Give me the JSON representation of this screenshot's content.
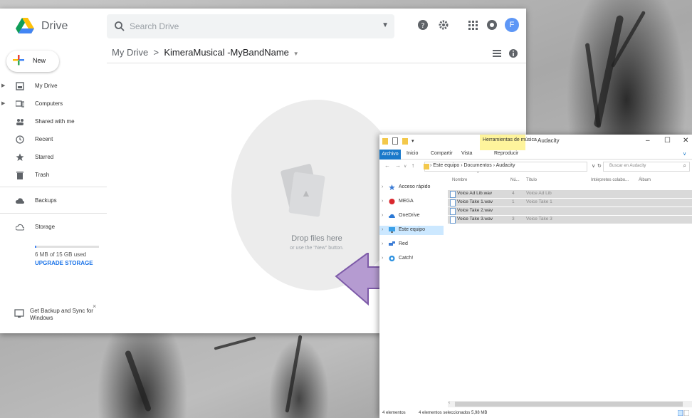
{
  "drive": {
    "app_name": "Drive",
    "search_placeholder": "Search Drive",
    "avatar_letter": "F",
    "breadcrumb_root": "My Drive",
    "breadcrumb_sep": ">",
    "breadcrumb_folder": "KimeraMusical -MyBandName",
    "new_label": "New",
    "nav": [
      {
        "label": "My Drive",
        "icon": "drive-icon"
      },
      {
        "label": "Computers",
        "icon": "computer-icon"
      },
      {
        "label": "Shared with me",
        "icon": "people-icon"
      },
      {
        "label": "Recent",
        "icon": "clock-icon"
      },
      {
        "label": "Starred",
        "icon": "star-icon"
      },
      {
        "label": "Trash",
        "icon": "trash-icon"
      },
      {
        "label": "Backups",
        "icon": "cloud-icon"
      },
      {
        "label": "Storage",
        "icon": "cloud-outline-icon"
      }
    ],
    "storage_used": "6 MB of 15 GB used",
    "storage_fraction": 0.0004,
    "upgrade_label": "UPGRADE STORAGE",
    "backup_promo": "Get Backup and Sync for Windows",
    "close_glyph": "×",
    "drop_title": "Drop files here",
    "drop_sub": "or use the \"New\" button."
  },
  "explorer": {
    "ribbon_context": "Herramientas de música",
    "ribbon_context_tab": "Reproducir",
    "app_title": "Audacity",
    "tabs": {
      "archivo": "Archivo",
      "inicio": "Inicio",
      "compartir": "Compartir",
      "vista": "Vista"
    },
    "window_buttons": {
      "min": "–",
      "max": "☐",
      "close": "✕"
    },
    "address_path": "›  Este equipo  ›  Documentos  ›  Audacity",
    "search_placeholder": "Buscar en Audacity",
    "tree": [
      {
        "label": "Acceso rápido",
        "icon": "star-icon",
        "color": "#3a7bd5"
      },
      {
        "label": "MEGA",
        "icon": "mega-icon",
        "color": "#d9272e"
      },
      {
        "label": "OneDrive",
        "icon": "onedrive-icon",
        "color": "#2a78d5"
      },
      {
        "label": "Este equipo",
        "icon": "pc-icon",
        "color": "#3aa0e8"
      },
      {
        "label": "Red",
        "icon": "network-icon",
        "color": "#3a7bd5"
      },
      {
        "label": "Catch!",
        "icon": "catch-icon",
        "color": "#2a90e0"
      }
    ],
    "columns": {
      "name": "Nombre",
      "num": "Nú...",
      "title": "Título",
      "artists": "Intérpretes colabo...",
      "album": "Álbum"
    },
    "files": [
      {
        "name": "Voice Ad Lib.wav",
        "num": "4",
        "title": "Voice Ad Lib"
      },
      {
        "name": "Voice Take 1.wav",
        "num": "1",
        "title": "Voice Take 1"
      },
      {
        "name": "Voice Take 2.wav",
        "num": "",
        "title": ""
      },
      {
        "name": "Voice Take 3.wav",
        "num": "3",
        "title": "Voice Take 3"
      }
    ],
    "status_count": "4 elementos",
    "status_selected": "4 elementos seleccionados  5,98 MB"
  },
  "colors": {
    "drive_accent": "#1a73e8",
    "arrow_fill": "#b59bd1",
    "arrow_stroke": "#7d5aa8",
    "explorer_accent": "#1979ca"
  }
}
